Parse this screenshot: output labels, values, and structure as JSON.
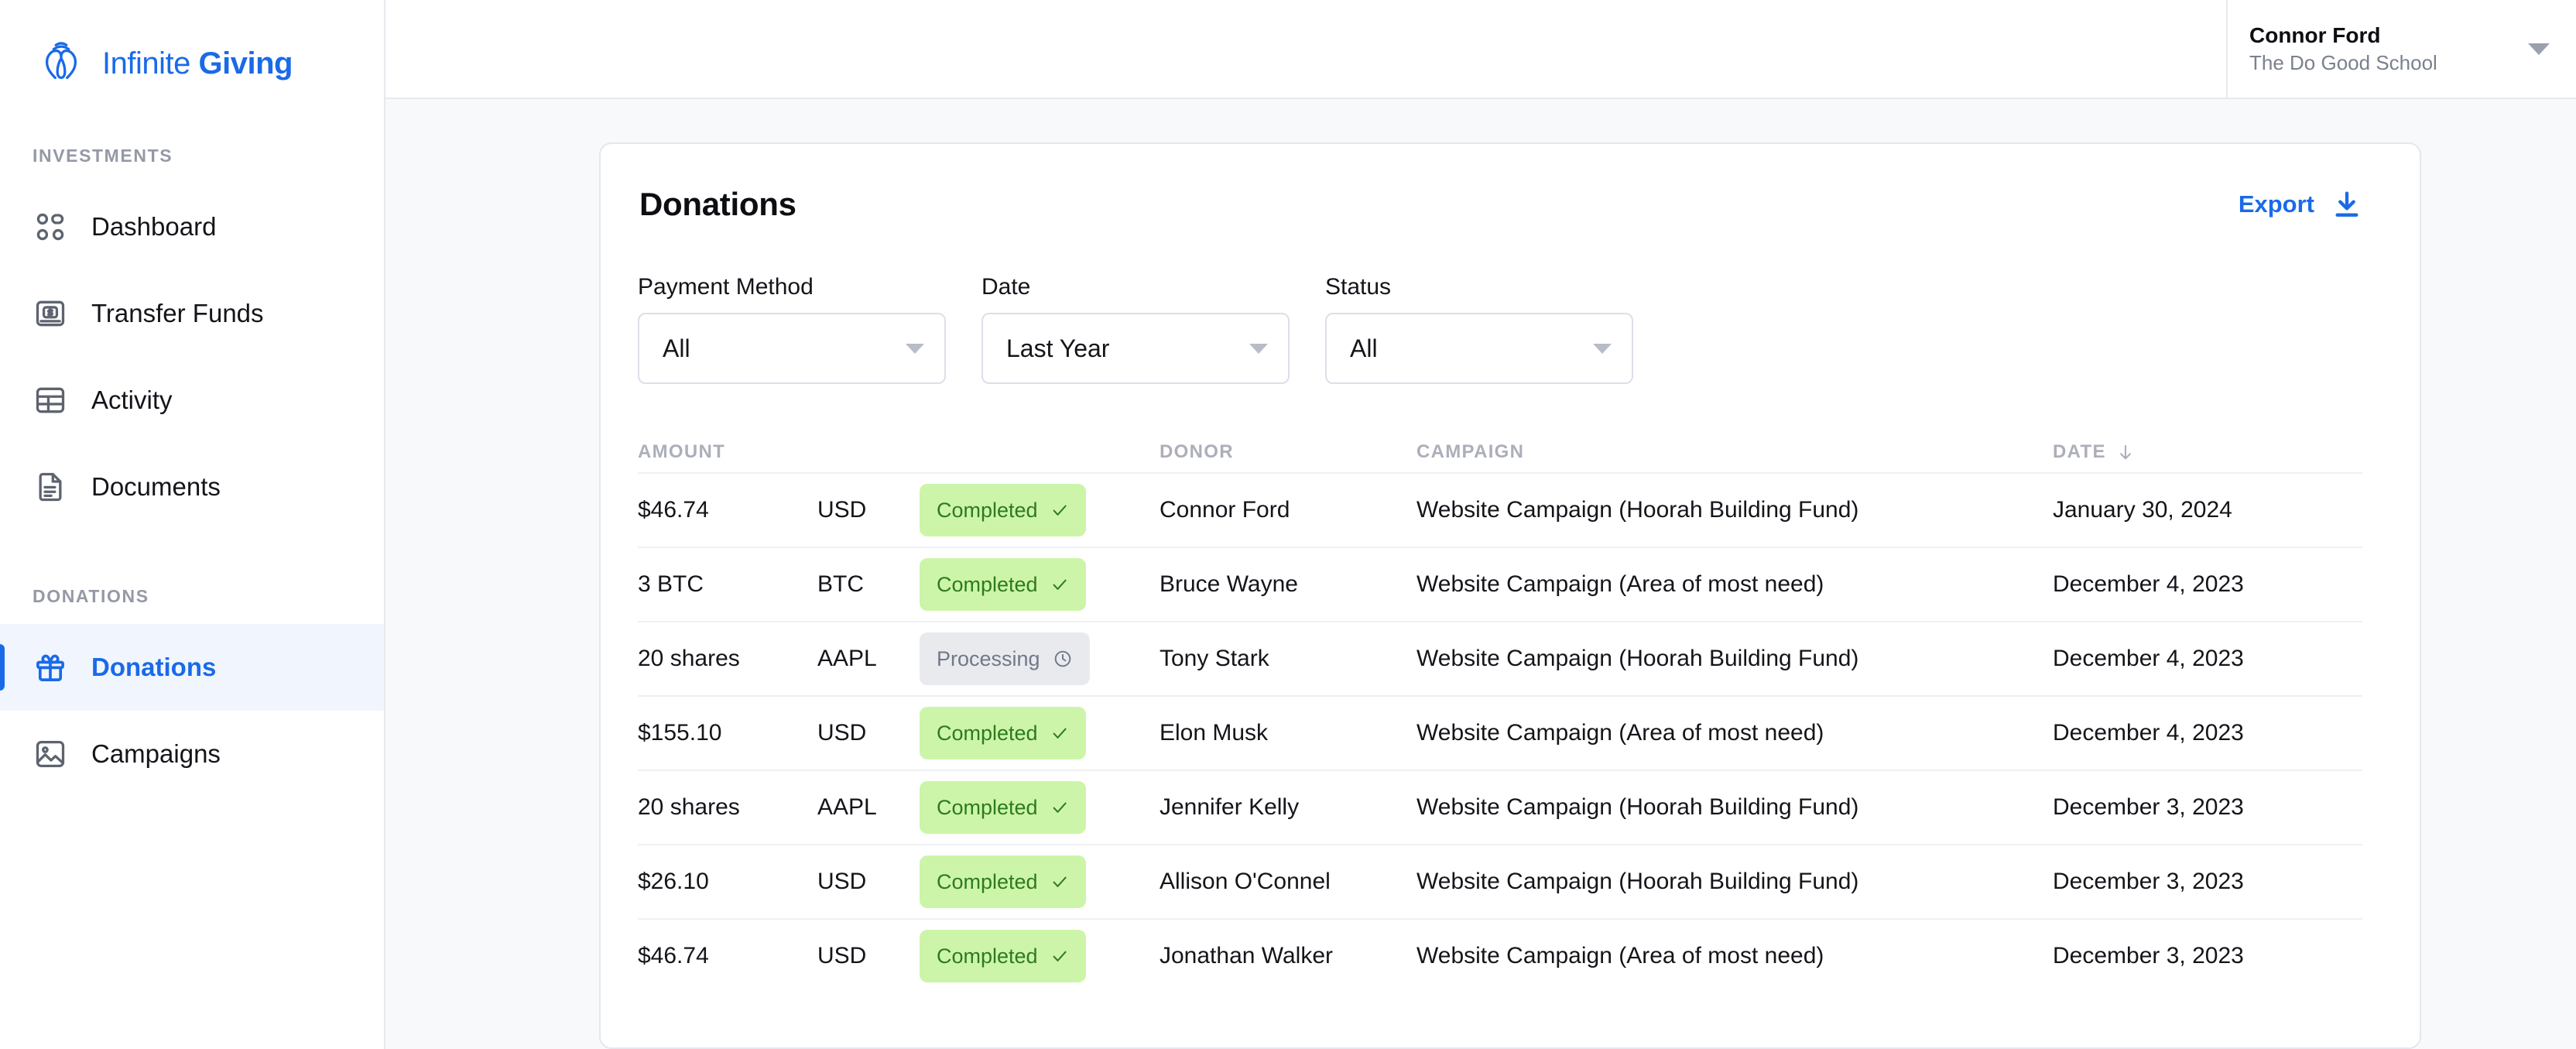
{
  "brand": {
    "light_word": "Infinite",
    "bold_word": "Giving",
    "logo_icon": "infinite-giving-logo-icon",
    "accent": "#1a6ae8"
  },
  "sidebar": {
    "sections": [
      {
        "label": "INVESTMENTS",
        "items": [
          {
            "label": "Dashboard",
            "icon": "dashboard-grid-icon",
            "active": false
          },
          {
            "label": "Transfer Funds",
            "icon": "money-card-icon",
            "active": false
          },
          {
            "label": "Activity",
            "icon": "table-icon",
            "active": false
          },
          {
            "label": "Documents",
            "icon": "document-icon",
            "active": false
          }
        ]
      },
      {
        "label": "DONATIONS",
        "items": [
          {
            "label": "Donations",
            "icon": "gift-icon",
            "active": true
          },
          {
            "label": "Campaigns",
            "icon": "image-icon",
            "active": false
          }
        ]
      }
    ]
  },
  "topbar": {
    "profile": {
      "name": "Connor Ford",
      "org": "The Do Good School",
      "caret_icon": "chevron-down-icon"
    }
  },
  "card": {
    "title": "Donations",
    "export": {
      "label": "Export",
      "icon": "download-icon"
    },
    "filters": [
      {
        "label": "Payment Method",
        "value": "All",
        "name": "payment-method"
      },
      {
        "label": "Date",
        "value": "Last Year",
        "name": "date"
      },
      {
        "label": "Status",
        "value": "All",
        "name": "status"
      }
    ],
    "table": {
      "headers": {
        "amount": "AMOUNT",
        "donor": "DONOR",
        "campaign": "CAMPAIGN",
        "date": "DATE",
        "date_sort_icon": "arrow-down-icon"
      },
      "rows": [
        {
          "amount": "$46.74",
          "currency": "USD",
          "status": "Completed",
          "status_kind": "completed",
          "status_icon": "check-icon",
          "donor": "Connor Ford",
          "campaign": "Website Campaign (Hoorah Building Fund)",
          "date": "January 30, 2024"
        },
        {
          "amount": "3 BTC",
          "currency": "BTC",
          "status": "Completed",
          "status_kind": "completed",
          "status_icon": "check-icon",
          "donor": "Bruce Wayne",
          "campaign": "Website Campaign (Area of most need)",
          "date": "December 4, 2023"
        },
        {
          "amount": "20 shares",
          "currency": "AAPL",
          "status": "Processing",
          "status_kind": "processing",
          "status_icon": "clock-icon",
          "donor": "Tony Stark",
          "campaign": "Website Campaign (Hoorah Building Fund)",
          "date": "December 4, 2023"
        },
        {
          "amount": "$155.10",
          "currency": "USD",
          "status": "Completed",
          "status_kind": "completed",
          "status_icon": "check-icon",
          "donor": "Elon Musk",
          "campaign": "Website Campaign (Area of most need)",
          "date": "December 4, 2023"
        },
        {
          "amount": "20 shares",
          "currency": "AAPL",
          "status": "Completed",
          "status_kind": "completed",
          "status_icon": "check-icon",
          "donor": "Jennifer Kelly",
          "campaign": "Website Campaign (Hoorah Building Fund)",
          "date": "December 3, 2023"
        },
        {
          "amount": "$26.10",
          "currency": "USD",
          "status": "Completed",
          "status_kind": "completed",
          "status_icon": "check-icon",
          "donor": "Allison O'Connel",
          "campaign": "Website Campaign (Hoorah Building Fund)",
          "date": "December 3, 2023"
        },
        {
          "amount": "$46.74",
          "currency": "USD",
          "status": "Completed",
          "status_kind": "completed",
          "status_icon": "check-icon",
          "donor": "Jonathan Walker",
          "campaign": "Website Campaign (Area of most need)",
          "date": "December 3, 2023"
        }
      ]
    }
  },
  "colors": {
    "accent": "#1a6ae8",
    "page_bg": "#f8f9fa",
    "badge_completed_bg": "#cdf5a9",
    "badge_completed_fg": "#2d7a1e",
    "badge_processing_bg": "#e8eaee",
    "badge_processing_fg": "#717888"
  }
}
